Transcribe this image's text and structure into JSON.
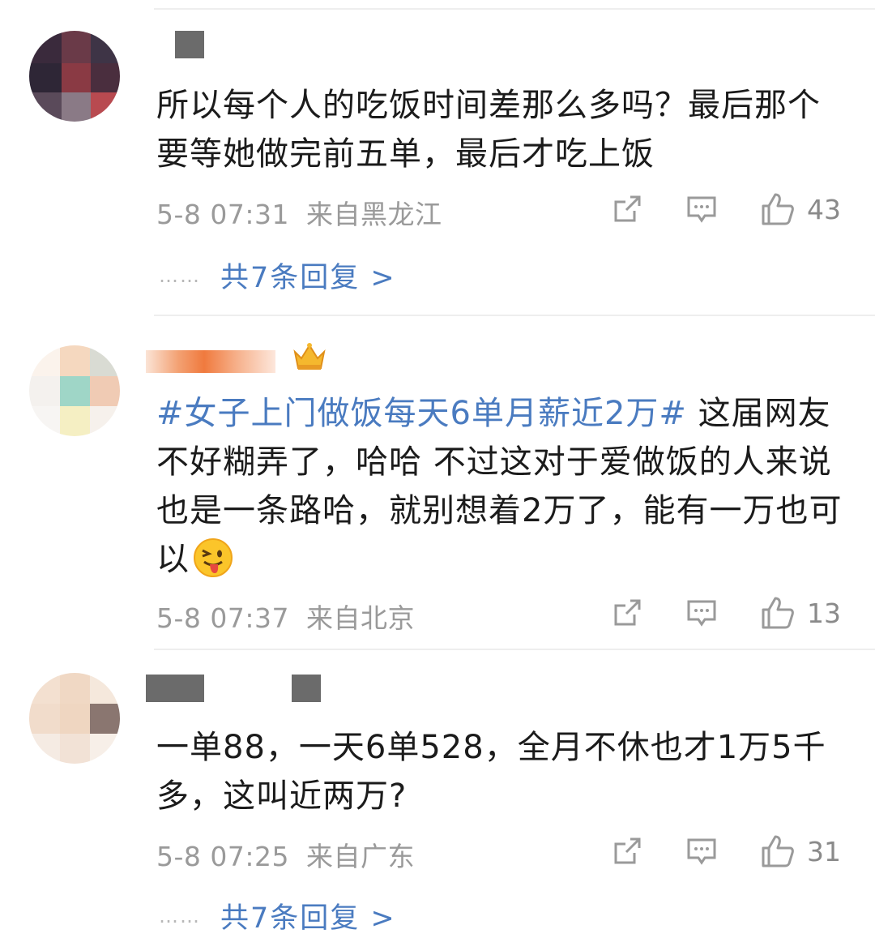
{
  "comments": [
    {
      "text": "所以每个人的吃饭时间差那么多吗？最后那个要等她做完前五单，最后才吃上饭",
      "time": "5-8 07:31",
      "location": "来自黑龙江",
      "likes": "43",
      "replies_label": "共7条回复 >",
      "dots": "……"
    },
    {
      "hashtag": "#女子上门做饭每天6单月薪近2万#",
      "text": " 这届网友不好糊弄了，哈哈 不过这对于爱做饭的人来说也是一条路哈，就别想着2万了，能有一万也可以",
      "time": "5-8 07:37",
      "location": "来自北京",
      "likes": "13"
    },
    {
      "text": "一单88，一天6单528，全月不休也才1万5千多，这叫近两万?",
      "time": "5-8 07:25",
      "location": "来自广东",
      "likes": "31",
      "replies_label": "共7条回复 >",
      "dots": "……"
    }
  ],
  "icons": {
    "share": "share-icon",
    "comment": "comment-icon",
    "like": "thumbs-up-icon",
    "emoji": "tongue-wink-emoji-icon",
    "badge": "crown-badge-icon"
  },
  "colors": {
    "link": "#4a7bc0",
    "meta": "#9a9a9a",
    "text": "#1b1b1b"
  }
}
